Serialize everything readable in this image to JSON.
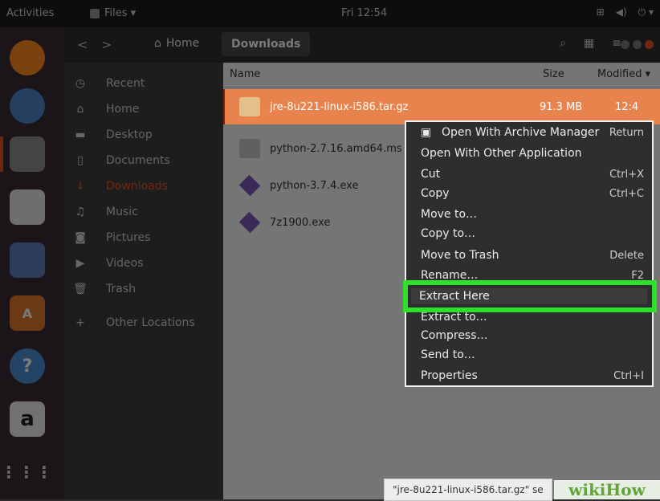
{
  "topbar": {
    "activities": "Activities",
    "app_menu": "Files ▾",
    "clock": "Fri 12:54"
  },
  "header": {
    "back": "<",
    "forward": ">",
    "crumb_home": "Home",
    "crumb_current": "Downloads"
  },
  "sidebar": {
    "items": [
      {
        "label": "Recent",
        "icon": "clock-icon"
      },
      {
        "label": "Home",
        "icon": "home-icon"
      },
      {
        "label": "Desktop",
        "icon": "folder-icon"
      },
      {
        "label": "Documents",
        "icon": "document-icon"
      },
      {
        "label": "Downloads",
        "icon": "download-icon",
        "active": true
      },
      {
        "label": "Music",
        "icon": "music-icon"
      },
      {
        "label": "Pictures",
        "icon": "camera-icon"
      },
      {
        "label": "Videos",
        "icon": "video-icon"
      },
      {
        "label": "Trash",
        "icon": "trash-icon"
      },
      {
        "label": "Other Locations",
        "icon": "plus-icon"
      }
    ]
  },
  "columns": {
    "name": "Name",
    "size": "Size",
    "modified": "Modified ▾"
  },
  "files": [
    {
      "name": "jre-8u221-linux-i586.tar.gz",
      "size": "91.3 MB",
      "modified": "12:4",
      "icon": "archive-icon"
    },
    {
      "name": "python-2.7.16.amd64.ms",
      "icon": "package-icon"
    },
    {
      "name": "python-3.7.4.exe",
      "icon": "exe-icon"
    },
    {
      "name": "7z1900.exe",
      "icon": "exe-icon"
    }
  ],
  "context_menu": [
    {
      "label": "Open With Archive Manager",
      "shortcut": "Return"
    },
    {
      "label": "Open With Other Application",
      "shortcut": ""
    },
    {
      "label": "Cut",
      "shortcut": "Ctrl+X"
    },
    {
      "label": "Copy",
      "shortcut": "Ctrl+C"
    },
    {
      "label": "Move to…",
      "shortcut": ""
    },
    {
      "label": "Copy to…",
      "shortcut": ""
    },
    {
      "label": "Move to Trash",
      "shortcut": "Delete"
    },
    {
      "label": "Rename…",
      "shortcut": "F2"
    },
    {
      "label": "Extract Here",
      "shortcut": ""
    },
    {
      "label": "Extract to…",
      "shortcut": ""
    },
    {
      "label": "Compress…",
      "shortcut": ""
    },
    {
      "label": "Send to…",
      "shortcut": ""
    },
    {
      "label": "Properties",
      "shortcut": "Ctrl+I"
    }
  ],
  "status": "\"jre-8u221-linux-i586.tar.gz\" se",
  "watermark": "wikiHow",
  "colors": {
    "accent": "#e95420",
    "highlight": "#2ee02a"
  }
}
